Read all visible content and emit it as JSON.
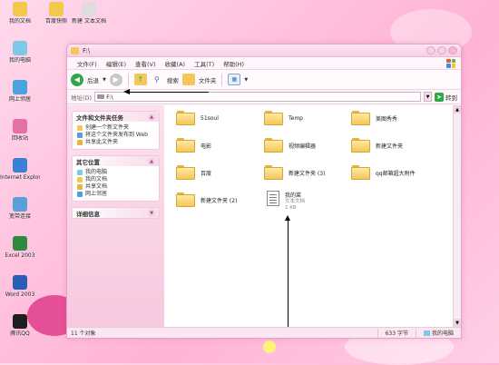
{
  "desktop_icons": [
    {
      "label": "我的文档",
      "color": "#f2c94c"
    },
    {
      "label": "我的电脑",
      "color": "#7ec9e8"
    },
    {
      "label": "网上邻居",
      "color": "#4aa3df"
    },
    {
      "label": "回收站",
      "color": "#e76fa8"
    },
    {
      "label": "Internet Explorer",
      "color": "#3b7fd6"
    },
    {
      "label": "宽带连接",
      "color": "#5aa0d8"
    },
    {
      "label": "Excel 2003",
      "color": "#2e8b3e"
    },
    {
      "label": "Word 2003",
      "color": "#2a5cb8"
    },
    {
      "label": "腾讯QQ",
      "color": "#1e1e1e"
    }
  ],
  "desktop_icons_col2": [
    {
      "label": "百度快照",
      "color": "#f2c94c"
    },
    {
      "label": "新建 文本文档",
      "color": "#dddddd"
    }
  ],
  "window": {
    "title": "F:\\",
    "menus": [
      "文件(F)",
      "编辑(E)",
      "查看(V)",
      "收藏(A)",
      "工具(T)",
      "帮助(H)"
    ],
    "toolbar": {
      "back_label": "后退",
      "search_label": "搜索",
      "folders_label": "文件夹"
    },
    "address": {
      "label": "地址(D)",
      "value": "F:\\",
      "go_label": "转到"
    },
    "task_panel": {
      "title": "文件和文件夹任务",
      "items": [
        "创建一个新文件夹",
        "将这个文件夹发布到 Web",
        "共享此文件夹"
      ]
    },
    "places_panel": {
      "title": "其它位置",
      "items": [
        "我的电脑",
        "我的文档",
        "共享文档",
        "网上邻居"
      ]
    },
    "details_panel": {
      "title": "详细信息"
    },
    "files": [
      {
        "name": "51soul",
        "type": "folder"
      },
      {
        "name": "Temp",
        "type": "folder"
      },
      {
        "name": "美图秀秀",
        "type": "folder"
      },
      {
        "name": "电影",
        "type": "folder"
      },
      {
        "name": "视频编辑器",
        "type": "folder"
      },
      {
        "name": "新建文件夹",
        "type": "folder"
      },
      {
        "name": "百度",
        "type": "folder"
      },
      {
        "name": "新建文件夹 (3)",
        "type": "folder"
      },
      {
        "name": "qq邮箱超大附件",
        "type": "folder"
      },
      {
        "name": "新建文件夹 (2)",
        "type": "folder"
      },
      {
        "name": "我的菜",
        "type": "text",
        "kind": "文本文档",
        "size": "1 KB"
      }
    ],
    "status": {
      "objects": "11 个对象",
      "size": "633 字节",
      "location": "我的电脑"
    }
  },
  "colors": {
    "accent": "#e76fa8",
    "window_border": "#e6a3c9"
  }
}
